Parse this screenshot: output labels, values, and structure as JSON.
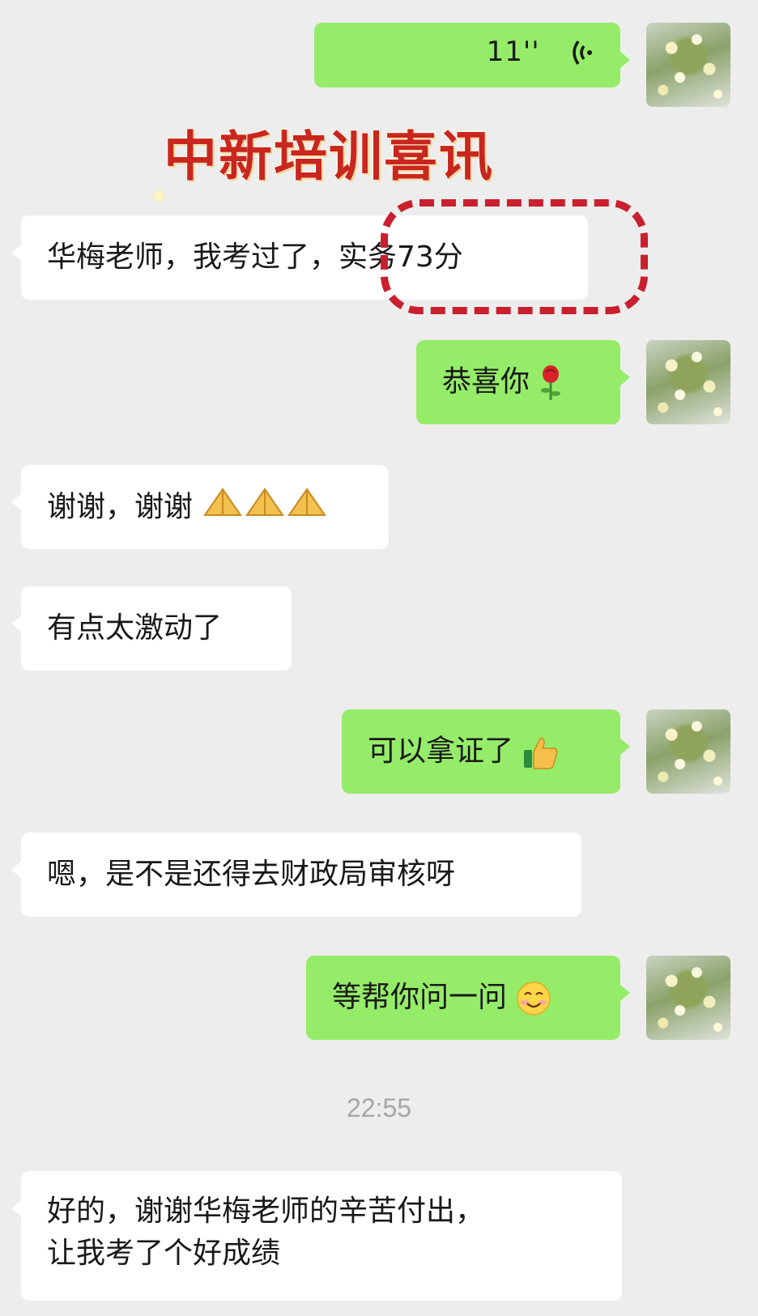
{
  "header": {
    "title": "中新培训喜讯"
  },
  "messages": [
    {
      "id": "m0",
      "side": "out",
      "type": "voice",
      "duration": "11''"
    },
    {
      "id": "m1",
      "side": "in",
      "text": "华梅老师，我考过了，实务73分"
    },
    {
      "id": "m2",
      "side": "out",
      "text": "恭喜你",
      "emoji": "rose-emoji"
    },
    {
      "id": "m3",
      "side": "in",
      "text": "谢谢，谢谢",
      "emoji": "folded-hands-emoji"
    },
    {
      "id": "m4",
      "side": "in",
      "text": "有点太激动了"
    },
    {
      "id": "m5",
      "side": "out",
      "text": "可以拿证了",
      "emoji": "thumbs-up-emoji"
    },
    {
      "id": "m6",
      "side": "in",
      "text": "嗯，是不是还得去财政局审核呀"
    },
    {
      "id": "m7",
      "side": "out",
      "text": "等帮你问一问",
      "emoji": "smile-emoji"
    },
    {
      "id": "m8",
      "side": "in",
      "lines": [
        "好的，谢谢华梅老师的辛苦付出，",
        "让我考了个好成绩"
      ]
    }
  ],
  "timestamp": "22:55",
  "colors": {
    "background": "#ededed",
    "outgoing_bubble": "#95ec69",
    "incoming_bubble": "#ffffff",
    "title_red": "#c8261f",
    "highlight_red": "#c91f2e"
  }
}
